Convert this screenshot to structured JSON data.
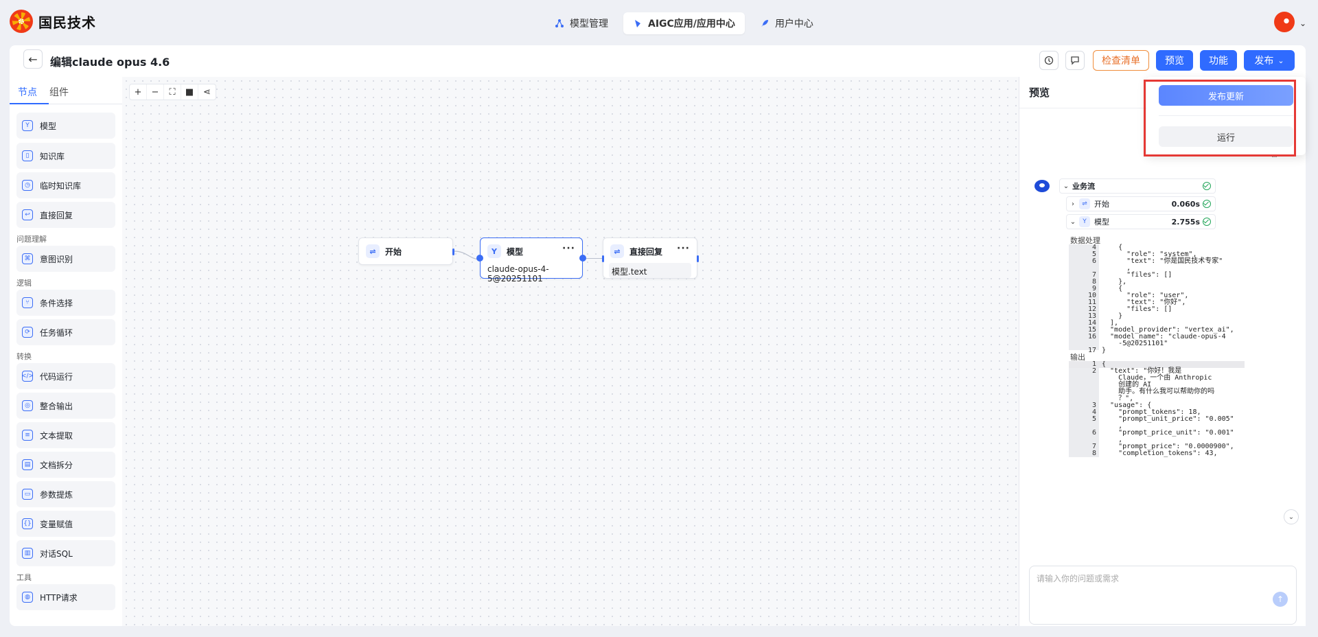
{
  "brand": {
    "name": "国民技术"
  },
  "nav": {
    "tabs": [
      {
        "label": "模型管理"
      },
      {
        "label": "AIGC应用/应用中心"
      },
      {
        "label": "用户中心"
      }
    ]
  },
  "header": {
    "title": "编辑claude opus 4.6",
    "checklist_label": "检查清单",
    "preview_label": "预览",
    "features_label": "功能",
    "publish_label": "发布"
  },
  "sidebar": {
    "tabs": [
      "节点",
      "组件"
    ],
    "items": [
      "模型",
      "知识库",
      "临时知识库",
      "直接回复",
      "意图识别",
      "条件选择",
      "任务循环",
      "代码运行",
      "整合输出",
      "文本提取",
      "文档拆分",
      "参数提炼",
      "变量赋值",
      "对话SQL",
      "HTTP请求"
    ],
    "groups": [
      "问题理解",
      "逻辑",
      "转换",
      "工具"
    ]
  },
  "flow": {
    "start": {
      "title": "开始"
    },
    "model": {
      "title": "模型",
      "body": "claude-opus-4-5@20251101"
    },
    "reply": {
      "title": "直接回复",
      "body": "模型.text"
    }
  },
  "preview": {
    "title": "预览",
    "workflow": {
      "label": "业务流",
      "steps": [
        {
          "label": "开始",
          "time": "0.060s"
        },
        {
          "label": "模型",
          "time": "2.755s"
        }
      ]
    },
    "data_label": "数据处理",
    "output_label": "输出",
    "input_placeholder": "请输入你的问题或需求",
    "code_input": [
      {
        "n": "4",
        "t": "    {"
      },
      {
        "n": "5",
        "t": "      \"role\": \"system\","
      },
      {
        "n": "6",
        "t": "      \"text\": \"你是国民技术专家\""
      },
      {
        "n": "",
        "t": "      ,"
      },
      {
        "n": "7",
        "t": "      \"files\": []"
      },
      {
        "n": "8",
        "t": "    },"
      },
      {
        "n": "9",
        "t": "    {"
      },
      {
        "n": "10",
        "t": "      \"role\": \"user\","
      },
      {
        "n": "11",
        "t": "      \"text\": \"你好\","
      },
      {
        "n": "12",
        "t": "      \"files\": []"
      },
      {
        "n": "13",
        "t": "    }"
      },
      {
        "n": "14",
        "t": "  ],"
      },
      {
        "n": "15",
        "t": "  \"model_provider\": \"vertex_ai\","
      },
      {
        "n": "16",
        "t": "  \"model_name\": \"claude-opus-4"
      },
      {
        "n": "",
        "t": "    -5@20251101\""
      },
      {
        "n": "17",
        "t": "}"
      }
    ],
    "code_output": [
      {
        "n": "1",
        "t": "{"
      },
      {
        "n": "2",
        "t": "  \"text\": \"你好！我是"
      },
      {
        "n": "",
        "t": "    Claude，一个由 Anthropic"
      },
      {
        "n": "",
        "t": "    创建的 AI"
      },
      {
        "n": "",
        "t": "    助手。有什么我可以帮助你的吗"
      },
      {
        "n": "",
        "t": "    ？\","
      },
      {
        "n": "3",
        "t": "  \"usage\": {"
      },
      {
        "n": "4",
        "t": "    \"prompt_tokens\": 18,"
      },
      {
        "n": "5",
        "t": "    \"prompt_unit_price\": \"0.005\""
      },
      {
        "n": "",
        "t": "    ,"
      },
      {
        "n": "6",
        "t": "    \"prompt_price_unit\": \"0.001\""
      },
      {
        "n": "",
        "t": "    ,"
      },
      {
        "n": "7",
        "t": "    \"prompt_price\": \"0.0000900\","
      },
      {
        "n": "8",
        "t": "    \"completion_tokens\": 43,"
      }
    ]
  },
  "dropdown": {
    "publish_update": "发布更新",
    "run": "运行"
  }
}
